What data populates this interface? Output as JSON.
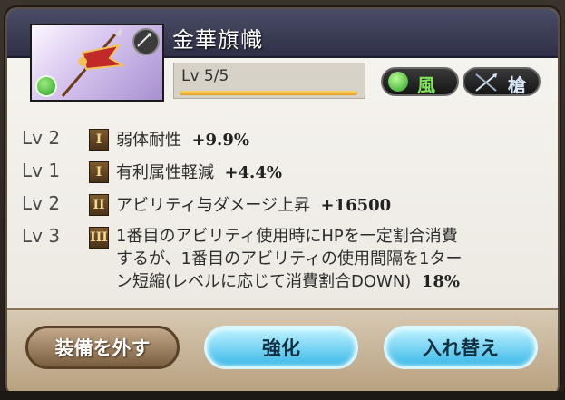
{
  "weapon": {
    "name": "金華旗幟",
    "level_text": "Lv 5/5",
    "level_progress": 1.0,
    "element_label": "風",
    "type_label": "槍"
  },
  "skills": [
    {
      "lv": "Lv 2",
      "rank": "I",
      "name": "弱体耐性",
      "value": "+9.9%"
    },
    {
      "lv": "Lv 1",
      "rank": "I",
      "name": "有利属性軽減",
      "value": "+4.4%"
    },
    {
      "lv": "Lv 2",
      "rank": "II",
      "name": "アビリティ与ダメージ上昇",
      "value": "+16500"
    },
    {
      "lv": "Lv 3",
      "rank": "III",
      "line1": "1番目のアビリティ使用時にHPを一定割合消費",
      "line2": "するが、1番目のアビリティの使用間隔を1ター",
      "line3": "ン短縮(レベルに応じて消費割合DOWN)",
      "value": "18%"
    }
  ],
  "buttons": {
    "remove": "装備を外す",
    "upgrade": "強化",
    "swap": "入れ替え"
  },
  "colors": {
    "header": "#35374f",
    "accent_upgrade": "#39b8e8",
    "element_wind": "#7fe35b"
  }
}
